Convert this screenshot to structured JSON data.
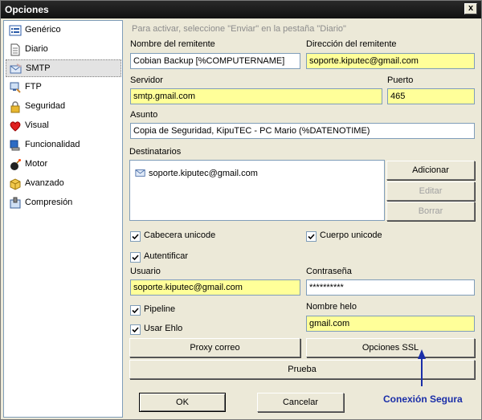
{
  "window": {
    "title": "Opciones",
    "close_glyph": "x"
  },
  "sidebar": {
    "items": [
      {
        "label": "Genérico",
        "icon": "list-icon"
      },
      {
        "label": "Diario",
        "icon": "document-icon"
      },
      {
        "label": "SMTP",
        "icon": "mail-icon",
        "selected": true
      },
      {
        "label": "FTP",
        "icon": "ftp-icon"
      },
      {
        "label": "Seguridad",
        "icon": "lock-icon"
      },
      {
        "label": "Visual",
        "icon": "heart-icon"
      },
      {
        "label": "Funcionalidad",
        "icon": "monitor-icon"
      },
      {
        "label": "Motor",
        "icon": "bomb-icon"
      },
      {
        "label": "Avanzado",
        "icon": "box-icon"
      },
      {
        "label": "Compresión",
        "icon": "compress-icon"
      }
    ]
  },
  "smtp": {
    "hint": "Para activar, seleccione \"Enviar\" en la pestaña \"Diario\"",
    "sender_name_label": "Nombre del remitente",
    "sender_name_value": "Cobian Backup [%COMPUTERNAME]",
    "sender_address_label": "Dirección del remitente",
    "sender_address_value": "soporte.kiputec@gmail.com",
    "server_label": "Servidor",
    "server_value": "smtp.gmail.com",
    "port_label": "Puerto",
    "port_value": "465",
    "subject_label": "Asunto",
    "subject_value": "Copia de Seguridad, KipuTEC - PC Mario (%DATENOTIME)",
    "recipients_label": "Destinatarios",
    "recipients": [
      "soporte.kiputec@gmail.com"
    ],
    "add_button": "Adicionar",
    "edit_button": "Editar",
    "delete_button": "Borrar",
    "header_unicode_label": "Cabecera unicode",
    "body_unicode_label": "Cuerpo unicode",
    "authenticate_label": "Autentificar",
    "user_label": "Usuario",
    "user_value": "soporte.kiputec@gmail.com",
    "password_label": "Contraseña",
    "password_value": "**********",
    "pipeline_label": "Pipeline",
    "ehlo_label": "Usar Ehlo",
    "helo_name_label": "Nombre helo",
    "helo_name_value": "gmail.com",
    "proxy_button": "Proxy correo",
    "ssl_button": "Opciones SSL",
    "test_button": "Prueba"
  },
  "footer": {
    "ok_button": "OK",
    "cancel_button": "Cancelar"
  },
  "annotation": {
    "text": "Conexión Segura",
    "color": "#1a2ea8"
  },
  "colors": {
    "highlight_field": "#ffff99",
    "dialog_bg": "#ece9d8"
  }
}
